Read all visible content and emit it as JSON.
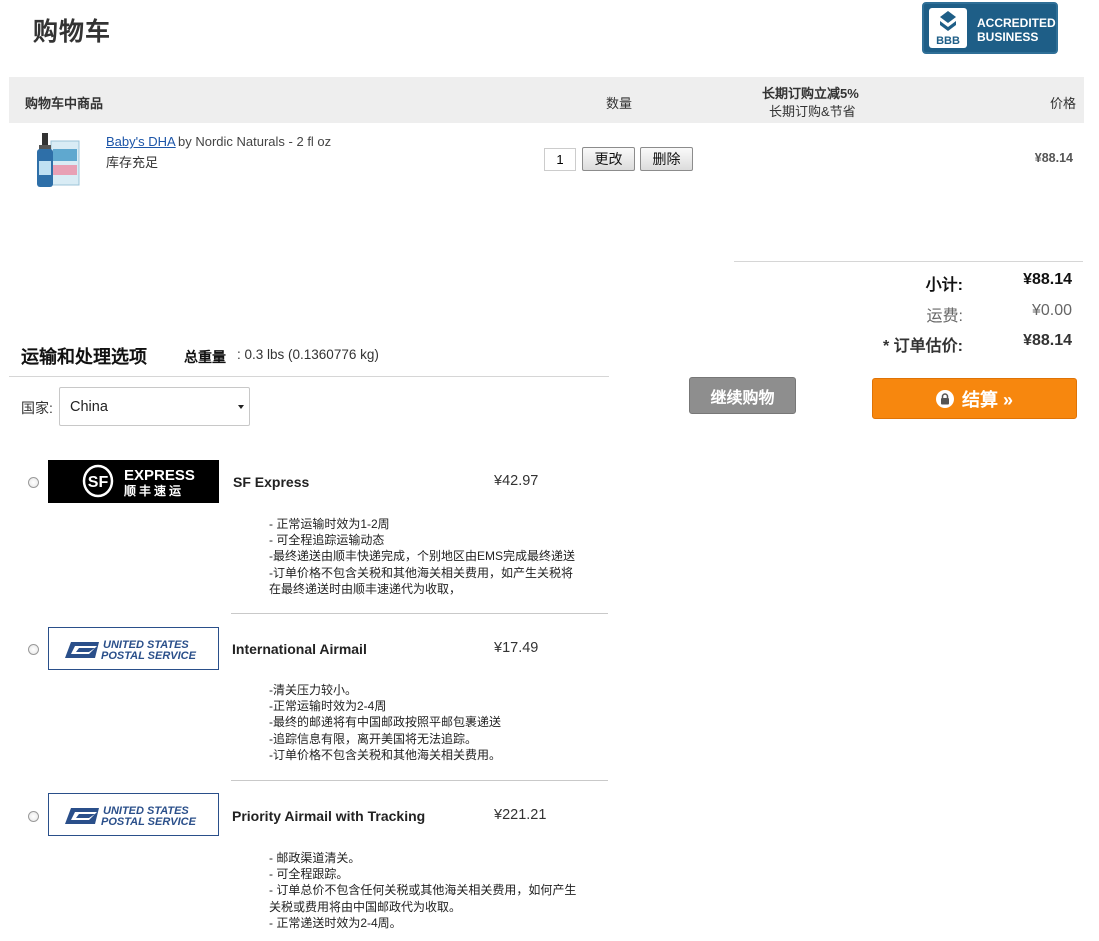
{
  "page": {
    "title": "购物车"
  },
  "badge": {
    "brand": "BBB",
    "line1": "ACCREDITED",
    "line2": "BUSINESS"
  },
  "cart": {
    "headers": {
      "items": "购物车中商品",
      "quantity": "数量",
      "promo_line1": "长期订购立减5%",
      "promo_line2": "长期订购&节省",
      "price": "价格"
    },
    "item": {
      "name": "Baby's DHA",
      "by": "by Nordic Naturals - 2 fl oz",
      "stock": "库存充足",
      "quantity": "1",
      "update_label": "更改",
      "delete_label": "删除",
      "price": "¥88.14"
    }
  },
  "totals": {
    "subtotal_label": "小计:",
    "subtotal_value": "¥88.14",
    "shipping_label": "运费:",
    "shipping_value": "¥0.00",
    "estimate_label": "* 订单估价:",
    "estimate_value": "¥88.14"
  },
  "actions": {
    "continue_label": "继续购物",
    "checkout_label": "结算 »"
  },
  "shipping": {
    "title": "运输和处理选项",
    "weight_label": "总重量",
    "weight_value": ": 0.3 lbs (0.1360776 kg)",
    "country_label": "国家:",
    "country_value": "China",
    "options": [
      {
        "logo": "SF EXPRESS 顺丰速运",
        "logo_en": "EXPRESS",
        "logo_cn": "顺丰速运",
        "logo_mark": "SF",
        "name": "SF Express",
        "price": "¥42.97",
        "notes": [
          "- 正常运输时效为1-2周",
          "- 可全程追踪运输动态",
          "-最终递送由顺丰快递完成，个别地区由EMS完成最终递送",
          "-订单价格不包含关税和其他海关相关费用，如产生关税将",
          "在最终递送时由顺丰速递代为收取，"
        ]
      },
      {
        "logo": "UNITED STATES POSTAL SERVICE",
        "logo_line1": "UNITED STATES",
        "logo_line2": "POSTAL SERVICE",
        "name": "International Airmail",
        "price": "¥17.49",
        "notes": [
          "-清关压力较小。",
          "-正常运输时效为2-4周",
          "-最终的邮递将有中国邮政按照平邮包裹递送",
          "-追踪信息有限，离开美国将无法追踪。",
          "-订单价格不包含关税和其他海关相关费用。"
        ]
      },
      {
        "logo": "UNITED STATES POSTAL SERVICE",
        "logo_line1": "UNITED STATES",
        "logo_line2": "POSTAL SERVICE",
        "name": "Priority Airmail with Tracking",
        "price": "¥221.21",
        "notes": [
          "- 邮政渠道清关。",
          "- 可全程跟踪。",
          "- 订单总价不包含任何关税或其他海关相关费用，如何产生",
          "关税或费用将由中国邮政代为收取。",
          "- 正常递送时效为2-4周。"
        ]
      }
    ]
  },
  "colors": {
    "checkout": "#f7870e",
    "continue": "#8e8e8e",
    "link": "#1c55a8",
    "promo": "#b01d1d",
    "bbb": "#1e5e87"
  }
}
